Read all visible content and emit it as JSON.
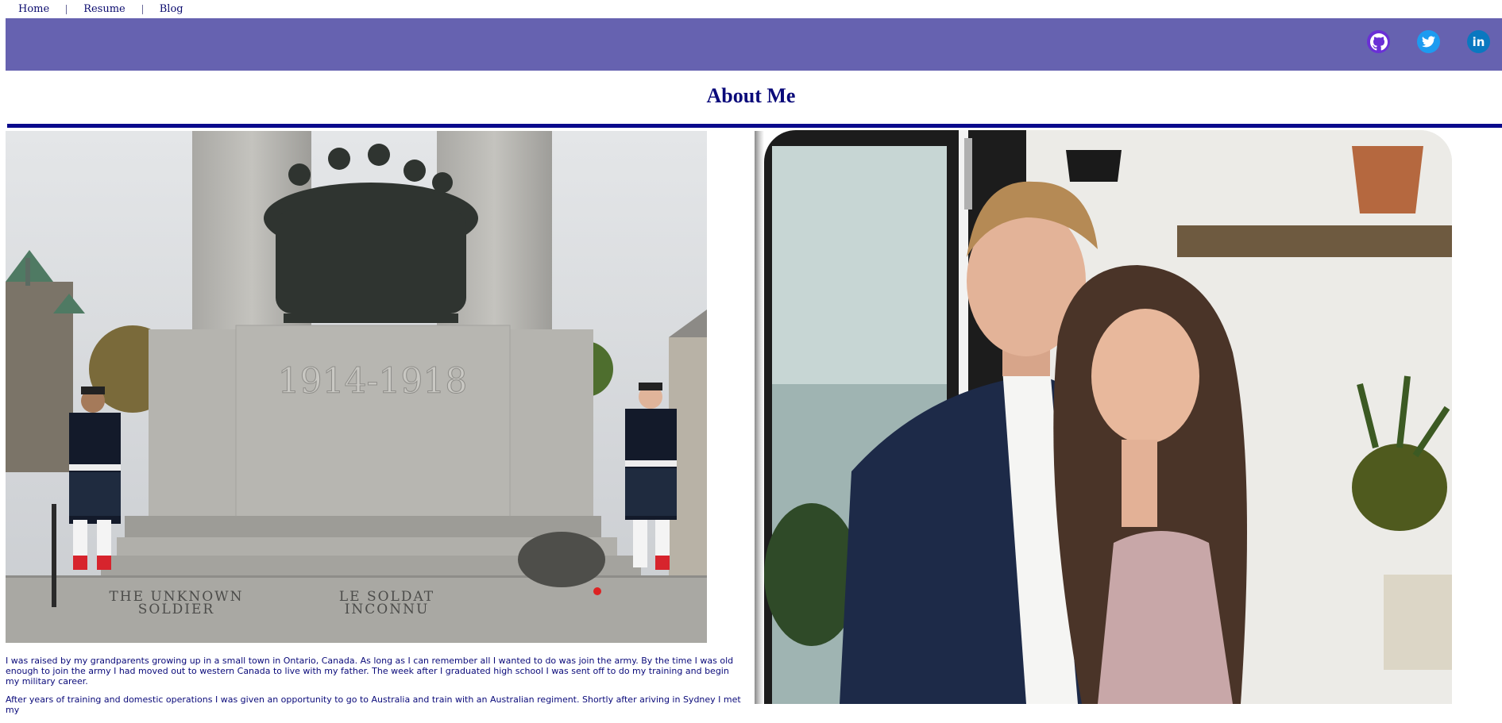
{
  "nav": {
    "items": [
      {
        "label": "Home"
      },
      {
        "label": "Resume"
      },
      {
        "label": "Blog"
      }
    ]
  },
  "social": {
    "icons": [
      "github-icon",
      "twitter-icon",
      "linkedin-icon"
    ],
    "linkedin_text": "in"
  },
  "colors": {
    "banner": "#6662b0",
    "heading": "#0a0a7a",
    "rule": "#0a0a8c"
  },
  "page": {
    "title": "About Me"
  },
  "memorial_photo": {
    "plinth_years": "1914-1918",
    "inscription_left": "THE UNKNOWN\nSOLDIER",
    "inscription_right": "LE SOLDAT\nINCONNU"
  },
  "bio": {
    "paragraphs": [
      "I was raised by my grandparents growing up in a small town in Ontario, Canada. As long as I can remember all I wanted to do was join the army. By the time I was old enough to join the army I had moved out to western Canada to live with my father. The week after I graduated high school I was sent off to do my training and begin my military career.",
      "After years of training and domestic operations I was given an opportunity to go to Australia and train with an Australian regiment. Shortly after ariving in Sydney I met my"
    ]
  }
}
